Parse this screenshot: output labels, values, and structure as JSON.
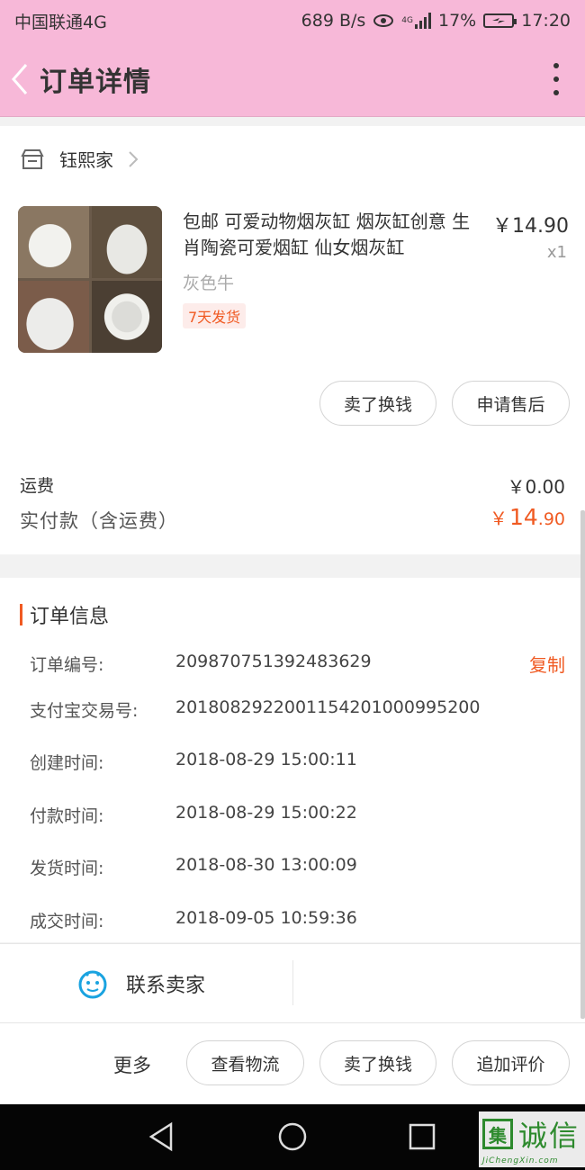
{
  "status_bar": {
    "carrier": "中国联通4G",
    "speed": "689 B/s",
    "network": "4G",
    "battery": "17%",
    "time": "17:20",
    "icons": [
      "eye-icon",
      "signal-icon",
      "battery-charging-icon"
    ]
  },
  "nav": {
    "title": "订单详情",
    "icons": [
      "back-chevron-icon",
      "more-vertical-icon"
    ]
  },
  "order": {
    "shop_name": "钰熙家",
    "product_title": "包邮 可爱动物烟灰缸 烟灰缸创意 生肖陶瓷可爱烟缸 仙女烟灰缸",
    "price": "￥14.90",
    "quantity": "x1",
    "variant": "灰色牛",
    "ship_badge": "7天发货",
    "buttons": {
      "sell": "卖了换钱",
      "after_sale": "申请售后"
    },
    "shipping_label": "运费",
    "shipping_value": "￥0.00",
    "paid_label": "实付款（含运费）",
    "paid_currency": "￥",
    "paid_integer": "14",
    "paid_decimal": ".90"
  },
  "order_info": {
    "title": "订单信息",
    "copy_label": "复制",
    "rows": [
      {
        "key": "订单编号:",
        "value": "209870751392483629"
      },
      {
        "key": "支付宝交易号:",
        "value": "2018082922001154201000995200"
      },
      {
        "key": "创建时间:",
        "value": "2018-08-29 15:00:11"
      },
      {
        "key": "付款时间:",
        "value": "2018-08-29 15:00:22"
      },
      {
        "key": "发货时间:",
        "value": "2018-08-30 13:00:09"
      },
      {
        "key": "成交时间:",
        "value": "2018-09-05 10:59:36"
      }
    ]
  },
  "contact": {
    "label": "联系卖家"
  },
  "actions": {
    "more": "更多",
    "logistics": "查看物流",
    "sell": "卖了换钱",
    "review": "追加评价"
  },
  "watermark": {
    "box": "集",
    "text": "诚信",
    "sub": "JiChengXin.com"
  },
  "colors": {
    "header": "#f7b8d8",
    "accent": "#f05a22"
  }
}
